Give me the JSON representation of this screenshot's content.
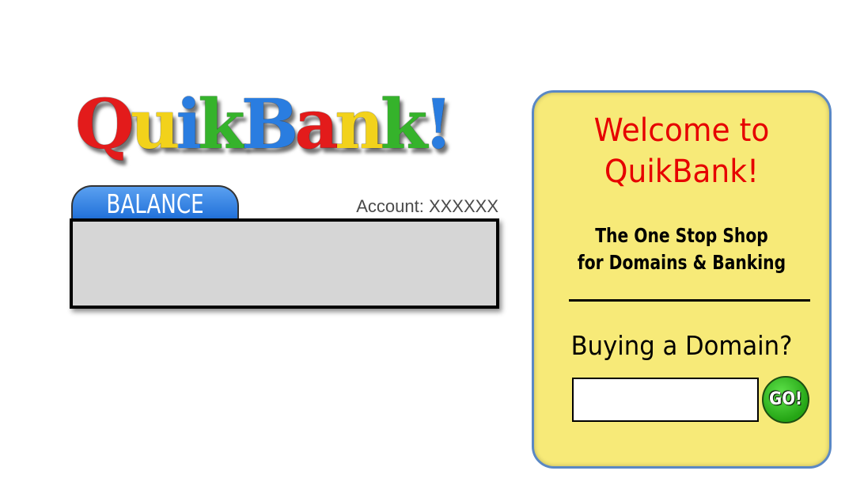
{
  "logo": {
    "letters": [
      {
        "char": "Q",
        "color": "#e31b1b"
      },
      {
        "char": "u",
        "color": "#f2d21b"
      },
      {
        "char": "i",
        "color": "#2a7de0"
      },
      {
        "char": "k",
        "color": "#35b32b"
      },
      {
        "char": "B",
        "color": "#2a7de0"
      },
      {
        "char": "a",
        "color": "#e31b1b"
      },
      {
        "char": "n",
        "color": "#f2d21b"
      },
      {
        "char": "k",
        "color": "#35b32b"
      },
      {
        "char": "!",
        "color": "#2a7de0"
      }
    ]
  },
  "balance": {
    "tab_label": "BALANCE",
    "account_label": "Account: XXXXXX",
    "value": ""
  },
  "welcome": {
    "title_line1": "Welcome to",
    "title_line2": "QuikBank!",
    "tagline_line1": "The One Stop Shop",
    "tagline_line2": "for Domains & Banking",
    "domain_heading": "Buying a Domain?",
    "domain_input_value": "",
    "go_label": "GO!"
  },
  "colors": {
    "panel_background": "#f7ea78",
    "panel_border": "#5a88c5",
    "welcome_title": "#e60000",
    "balance_tab": "#1f6fd8",
    "go_button": "#25a515"
  }
}
